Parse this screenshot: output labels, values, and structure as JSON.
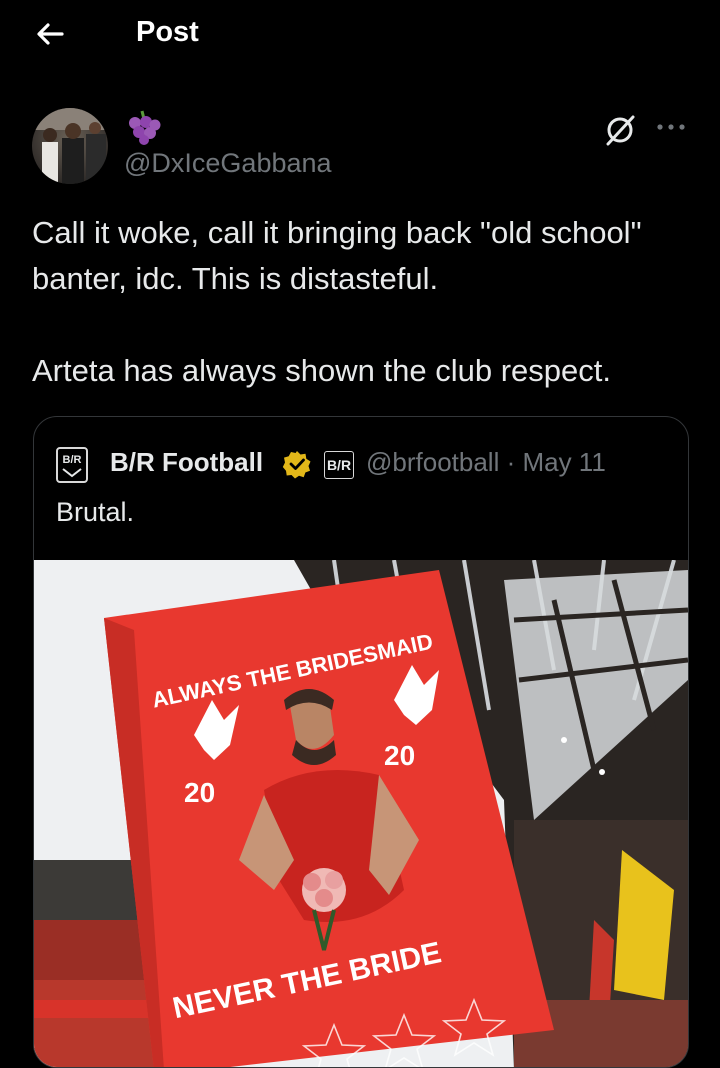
{
  "header": {
    "title": "Post",
    "back_icon": "arrow-left-icon"
  },
  "post": {
    "handle": "@DxIceGabbana",
    "emoji_icon": "grapes-icon",
    "text_lines": [
      "Call it woke, call it bringing back \"old school\" banter, idc.  This is distasteful.",
      "Arteta has always shown the club respect."
    ]
  },
  "quote": {
    "name": "B/R Football",
    "badge": "B/R",
    "logo_text": "B/R",
    "handle_date": "@brfootball · May 11",
    "text": "Brutal.",
    "banner": {
      "top_text": "ALWAYS THE BRIDESMAID",
      "bottom_text": "NEVER THE BRIDE",
      "number_left": "20",
      "number_right": "20"
    }
  },
  "colors": {
    "background": "#000000",
    "text": "#e7e9ea",
    "muted": "#71767b",
    "verified": "#e2b719",
    "banner": "#e8382f"
  }
}
